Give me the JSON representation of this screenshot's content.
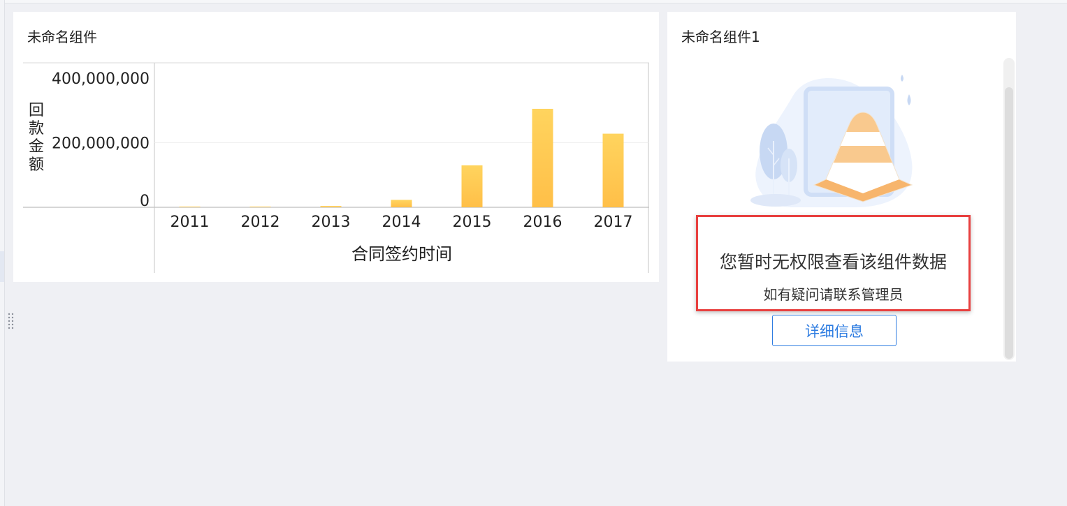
{
  "widget_left": {
    "title": "未命名组件"
  },
  "widget_right": {
    "title": "未命名组件1",
    "message": "您暂时无权限查看该组件数据",
    "sub_message": "如有疑问请联系管理员",
    "detail_button_label": "详细信息"
  },
  "colors": {
    "bar_top": "#ffd45e",
    "bar_bottom": "#ffbf48",
    "accent_blue": "#2f7de1",
    "highlight_red": "#e8403f",
    "page_bg": "#eff0f4"
  },
  "icons": {
    "drag_handle": "drag-dots-icon",
    "no_permission": "traffic-cone-illustration"
  },
  "chart_data": {
    "type": "bar",
    "categories": [
      "2011",
      "2012",
      "2013",
      "2014",
      "2015",
      "2016",
      "2017"
    ],
    "values": [
      1200000,
      1500000,
      4000000,
      23000000,
      130000000,
      305000000,
      228000000
    ],
    "y_tick_labels": [
      "400,000,000",
      "200,000,000",
      "0"
    ],
    "y_ticks": [
      400000000,
      200000000,
      0
    ],
    "ylim": [
      0,
      400000000
    ],
    "xlabel": "合同签约时间",
    "ylabel": "回款金额",
    "grid": true
  }
}
